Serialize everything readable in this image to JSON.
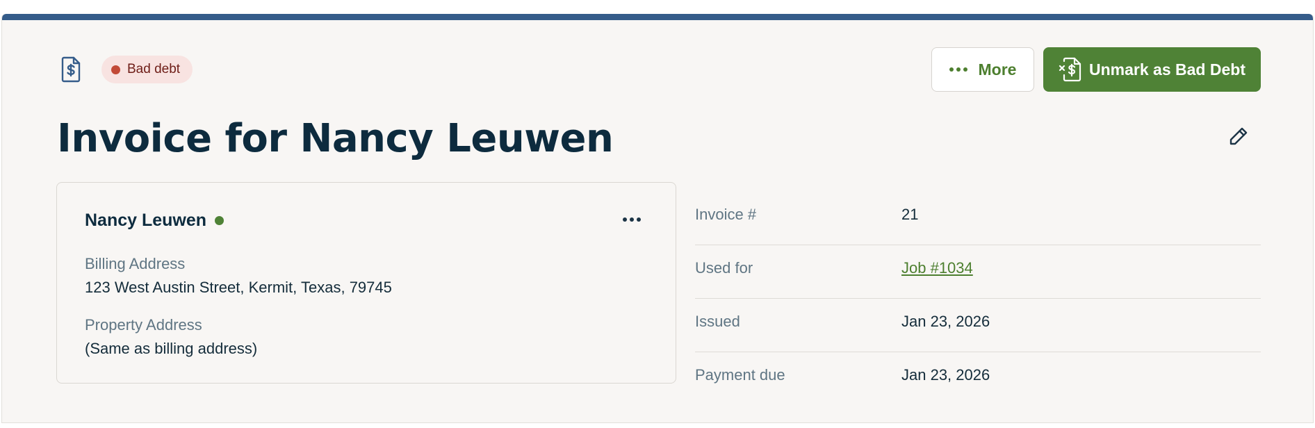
{
  "header": {
    "type_icon": "invoice-dollar-icon",
    "status_badge": "Bad debt",
    "more_button": "More",
    "primary_button": "Unmark as Bad Debt",
    "primary_button_icon": "unmark-bad-debt-icon",
    "edit_icon": "pencil-icon"
  },
  "title": "Invoice for Nancy Leuwen",
  "client": {
    "name": "Nancy Leuwen",
    "billing_label": "Billing Address",
    "billing_value": "123 West Austin Street, Kermit, Texas, 79745",
    "property_label": "Property Address",
    "property_value": "(Same as billing address)"
  },
  "details": [
    {
      "label": "Invoice #",
      "value": "21"
    },
    {
      "label": "Used for",
      "value": "Job #1034"
    },
    {
      "label": "Issued",
      "value": "Jan 23, 2026"
    },
    {
      "label": "Payment due",
      "value": "Jan 23, 2026"
    }
  ],
  "colors": {
    "accent_bar": "#355c8a",
    "primary_green": "#4f8236",
    "badge_bg": "#f8e3e1",
    "badge_dot": "#c24a37"
  }
}
